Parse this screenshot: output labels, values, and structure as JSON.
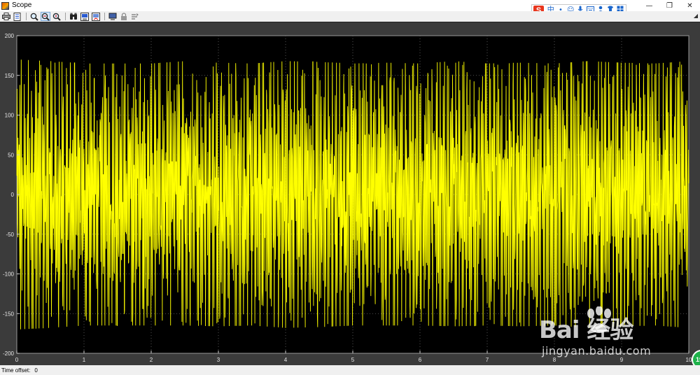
{
  "window": {
    "title": "Scope",
    "buttons": [
      "minimize",
      "restore",
      "close"
    ]
  },
  "toolbar": {
    "buttons": [
      {
        "name": "print",
        "icon": "printer-icon"
      },
      {
        "name": "parameters",
        "icon": "parameters-icon"
      },
      {
        "name": "zoom",
        "icon": "zoom-in-icon"
      },
      {
        "name": "zoom-x",
        "icon": "zoom-x-icon",
        "active": true
      },
      {
        "name": "zoom-y",
        "icon": "zoom-y-icon"
      },
      {
        "name": "autoscale",
        "icon": "binoculars-icon"
      },
      {
        "name": "save-axes",
        "icon": "save-axes-icon"
      },
      {
        "name": "restore-axes",
        "icon": "restore-axes-icon"
      },
      {
        "name": "floating-scope",
        "icon": "floating-scope-icon"
      },
      {
        "name": "lock-axes",
        "icon": "lock-icon"
      },
      {
        "name": "signal-selection",
        "icon": "signal-selection-icon"
      }
    ]
  },
  "ime_toolbar": {
    "logo": "S",
    "items": [
      "中",
      "•",
      "☺",
      "🎤",
      "⌨",
      "👤",
      "👕",
      "⋯"
    ]
  },
  "chart_data": {
    "type": "line",
    "title": "",
    "xlabel": "",
    "ylabel": "",
    "xlim": [
      0,
      10
    ],
    "ylim": [
      -200,
      200
    ],
    "xticks": [
      0,
      1,
      2,
      3,
      4,
      5,
      6,
      7,
      8,
      9,
      10
    ],
    "yticks": [
      -200,
      -150,
      -100,
      -50,
      0,
      50,
      100,
      150,
      200
    ],
    "grid": true,
    "background": "#000000",
    "series": [
      {
        "color": "#ffff00",
        "description": "dense oscillating signal, amplitude approx 170",
        "amplitude": 170,
        "x": [
          0,
          0.5,
          1,
          1.5,
          2,
          2.5,
          3,
          3.5,
          4,
          4.5,
          5,
          5.5,
          6,
          6.5,
          7,
          7.5,
          8,
          8.5,
          9,
          9.5,
          10
        ],
        "upper_envelope": [
          170,
          168,
          165,
          165,
          165,
          168,
          166,
          165,
          168,
          167,
          165,
          166,
          165,
          168,
          165,
          166,
          165,
          168,
          166,
          165,
          168
        ],
        "lower_envelope": [
          -170,
          -168,
          -165,
          -165,
          -165,
          -165,
          -166,
          -165,
          -168,
          -167,
          -165,
          -165,
          -165,
          -166,
          -165,
          -166,
          -165,
          -168,
          -166,
          -165,
          -168
        ]
      }
    ]
  },
  "status": {
    "time_offset_label": "Time offset:",
    "time_offset_value": "0"
  },
  "watermark": {
    "brand": "Bai  经验",
    "url": "jingyan.baidu.com",
    "badge": "19"
  }
}
